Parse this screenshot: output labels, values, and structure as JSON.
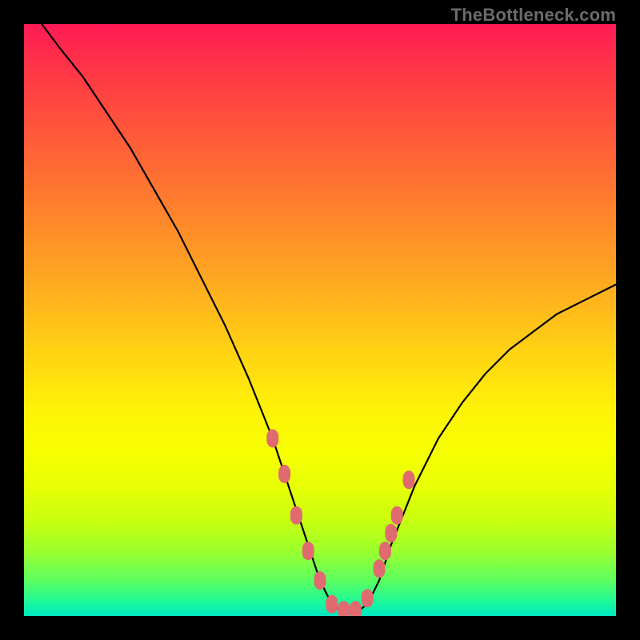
{
  "attribution": "TheBottleneck.com",
  "colors": {
    "gradient_top": "#ff1a55",
    "gradient_mid": "#fff207",
    "gradient_bottom": "#00e6c2",
    "markers": "#e06a6f",
    "curve": "#000000",
    "frame": "#000000"
  },
  "chart_data": {
    "type": "line",
    "title": "",
    "xlabel": "",
    "ylabel": "",
    "xlim": [
      0,
      100
    ],
    "ylim": [
      0,
      100
    ],
    "description": "Unlabeled V-shaped bottleneck curve on a vertical rainbow gradient. Lower y = better (green). Curve descends steeply from top-left, reaches a flat minimum near y≈0 around x≈50–55, then rises again toward the right. A cluster of pale-red markers sits along the curve near the minimum on both sides.",
    "series": [
      {
        "name": "bottleneck-curve",
        "x": [
          3,
          6,
          10,
          14,
          18,
          22,
          26,
          30,
          34,
          38,
          42,
          46,
          50,
          52,
          54,
          56,
          58,
          60,
          62,
          66,
          70,
          74,
          78,
          82,
          86,
          90,
          94,
          98,
          100
        ],
        "y": [
          100,
          96,
          91,
          85,
          79,
          72,
          65,
          57,
          49,
          40,
          30,
          18,
          6,
          2,
          0.5,
          0.5,
          2,
          6,
          12,
          22,
          30,
          36,
          41,
          45,
          48,
          51,
          53,
          55,
          56
        ]
      }
    ],
    "markers": {
      "name": "highlighted-points",
      "x": [
        42,
        44,
        46,
        48,
        50,
        52,
        54,
        56,
        58,
        60,
        61,
        62,
        63,
        65
      ],
      "y": [
        30,
        24,
        17,
        11,
        6,
        2,
        1,
        1,
        3,
        8,
        11,
        14,
        17,
        23
      ]
    }
  }
}
